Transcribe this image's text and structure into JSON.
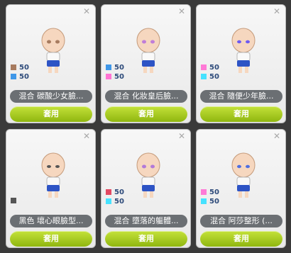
{
  "cards": [
    {
      "name": "混合 碳酸少女臉...",
      "button": "套用",
      "swatches": [
        {
          "color": "#a77b5f",
          "pct": "50"
        },
        {
          "color": "#3f97e8",
          "pct": "50"
        }
      ]
    },
    {
      "name": "混合 化妝皇后臉...",
      "button": "套用",
      "swatches": [
        {
          "color": "#3f97e8",
          "pct": "50"
        },
        {
          "color": "#ff73d3",
          "pct": "50"
        }
      ]
    },
    {
      "name": "混合 隨便少年臉...",
      "button": "套用",
      "swatches": [
        {
          "color": "#ff7ad6",
          "pct": "50"
        },
        {
          "color": "#46e2ff",
          "pct": "50"
        }
      ]
    },
    {
      "name": "黑色 壞心眼臉型...",
      "button": "套用",
      "swatches": [
        {
          "color": "#555555",
          "pct": ""
        }
      ]
    },
    {
      "name": "混合 墮落的軀體...",
      "button": "套用",
      "swatches": [
        {
          "color": "#e34962",
          "pct": "50"
        },
        {
          "color": "#46e2ff",
          "pct": "50"
        }
      ]
    },
    {
      "name": "混合 阿莎整形 (...",
      "button": "套用",
      "swatches": [
        {
          "color": "#ff7ad6",
          "pct": "50"
        },
        {
          "color": "#46e2ff",
          "pct": "50"
        }
      ]
    }
  ],
  "eye_colors": [
    "#a77b5f",
    "#c07dd8",
    "#6e5af0",
    "#555555",
    "#b27ad9",
    "#4f6fe0"
  ]
}
